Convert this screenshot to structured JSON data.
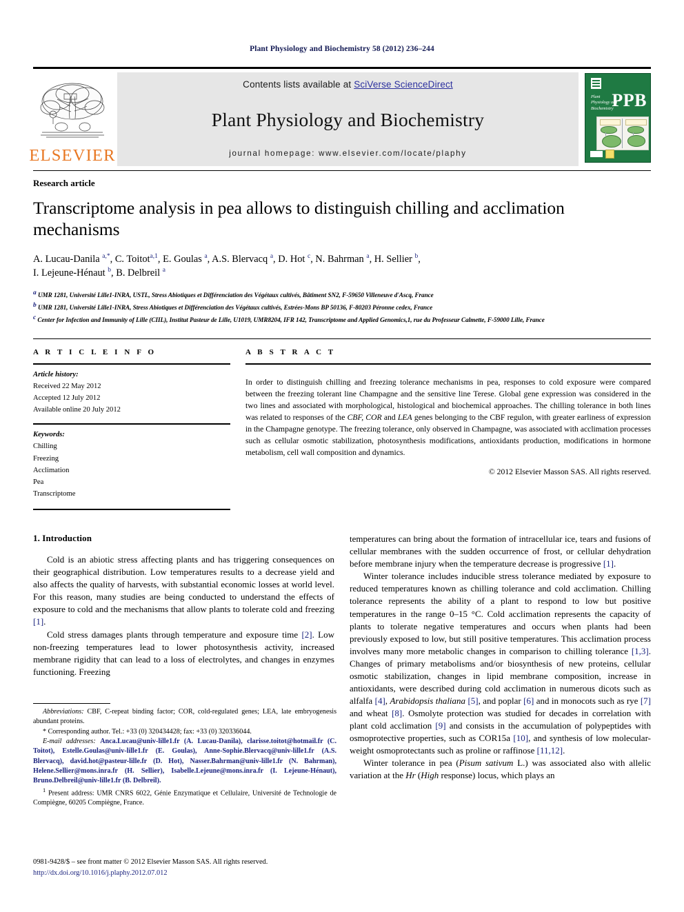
{
  "running_head": "Plant Physiology and Biochemistry 58 (2012) 236–244",
  "masthead": {
    "elsevier_wordmark": "ELSEVIER",
    "contents_prefix": "Contents lists available at ",
    "contents_link": "SciVerse ScienceDirect",
    "journal_name": "Plant Physiology and Biochemistry",
    "homepage": "journal homepage: www.elsevier.com/locate/plaphy",
    "cover": {
      "abbrev": "PPB",
      "journal_title_lines": "Plant Physiology and Biochemistry"
    }
  },
  "article": {
    "type": "Research article",
    "title": "Transcriptome analysis in pea allows to distinguish chilling and acclimation mechanisms",
    "authors_line1": "A. Lucau-Danila a,*, C. Toitot a,1, E. Goulas a, A.S. Blervacq a, D. Hot c, N. Bahrman a, H. Sellier b,",
    "authors_line2": "I. Lejeune-Hénaut b, B. Delbreil a",
    "affiliations": [
      "a UMR 1281, Université Lille1-INRA, USTL, Stress Abiotiques et Différenciation des Végétaux cultivés, Bâtiment SN2, F-59650 Villeneuve d'Ascq, France",
      "b UMR 1281, Université Lille1-INRA, Stress Abiotiques et Différenciation des Végétaux cultivés, Estrées-Mons BP 50136, F-80203 Péronne cedex, France",
      "c Center for Infection and Immunity of Lille (CIIL), Institut Pasteur de Lille, U1019, UMR8204, IFR 142, Transcriptome and Applied Genomics,1, rue du Professeur Calmette, F-59000 Lille, France"
    ]
  },
  "article_info": {
    "heading": "A R T I C L E  I N F O",
    "history_label": "Article history:",
    "history": [
      "Received 22 May 2012",
      "Accepted 12 July 2012",
      "Available online 20 July 2012"
    ],
    "keywords_label": "Keywords:",
    "keywords": [
      "Chilling",
      "Freezing",
      "Acclimation",
      "Pea",
      "Transcriptome"
    ]
  },
  "abstract": {
    "heading": "A B S T R A C T",
    "text_part1": "In order to distinguish chilling and freezing tolerance mechanisms in pea, responses to cold exposure were compared between the freezing tolerant line Champagne and the sensitive line Terese. Global gene expression was considered in the two lines and associated with morphological, histological and biochemical approaches. The chilling tolerance in both lines was related to responses of the ",
    "italic1": "CBF, COR",
    "text_part2": " and ",
    "italic2": "LEA",
    "text_part3": " genes belonging to the CBF regulon, with greater earliness of expression in the Champagne genotype. The freezing tolerance, only observed in Champagne, was associated with acclimation processes such as cellular osmotic stabilization, photosynthesis modifications, antioxidants production, modifications in hormone metabolism, cell wall composition and dynamics.",
    "copyright": "© 2012 Elsevier Masson SAS. All rights reserved."
  },
  "introduction": {
    "heading": "1. Introduction",
    "left_p1_a": "Cold is an abiotic stress affecting plants and has triggering consequences on their geographical distribution. Low temperatures results to a decrease yield and also affects the quality of harvests, with substantial economic losses at world level. For this reason, many studies are being conducted to understand the effects of exposure to cold and the mechanisms that allow plants to tolerate cold and freezing ",
    "left_p1_ref": "[1]",
    "left_p1_b": ".",
    "left_p2_a": "Cold stress damages plants through temperature and exposure time ",
    "left_p2_ref": "[2]",
    "left_p2_b": ". Low non-freezing temperatures lead to lower photosynthesis activity, increased membrane rigidity that can lead to a loss of electrolytes, and changes in enzymes functioning. Freezing",
    "right_p1_a": "temperatures can bring about the formation of intracellular ice, tears and fusions of cellular membranes with the sudden occurrence of frost, or cellular dehydration before membrane injury when the temperature decrease is progressive ",
    "right_p1_ref": "[1]",
    "right_p1_b": ".",
    "right_p2_a": "Winter tolerance includes inducible stress tolerance mediated by exposure to reduced temperatures known as chilling tolerance and cold acclimation. Chilling tolerance represents the ability of a plant to respond to low but positive temperatures in the range 0–15 °C. Cold acclimation represents the capacity of plants to tolerate negative temperatures and occurs when plants had been previously exposed to low, but still positive temperatures. This acclimation process involves many more metabolic changes in comparison to chilling tolerance ",
    "right_p2_ref1": "[1,3]",
    "right_p2_b": ". Changes of primary metabolisms and/or biosynthesis of new proteins, cellular osmotic stabilization, changes in lipid membrane composition, increase in antioxidants, were described during cold acclimation in numerous dicots such as alfalfa ",
    "right_p2_ref2": "[4]",
    "right_p2_c": ", ",
    "right_p2_italic1": "Arabidopsis thaliana",
    "right_p2_ref3": "[5]",
    "right_p2_d": ", and poplar ",
    "right_p2_ref4": "[6]",
    "right_p2_e": " and in monocots such as rye ",
    "right_p2_ref5": "[7]",
    "right_p2_f": " and wheat ",
    "right_p2_ref6": "[8]",
    "right_p2_g": ". Osmolyte protection was studied for decades in correlation with plant cold acclimation ",
    "right_p2_ref7": "[9]",
    "right_p2_h": " and consists in the accumulation of polypeptides with osmoprotective properties, such as COR15a ",
    "right_p2_ref8": "[10]",
    "right_p2_i": ", and synthesis of low molecular-weight osmoprotectants such as proline or raffinose ",
    "right_p2_ref9": "[11,12]",
    "right_p2_j": ".",
    "right_p3_a": "Winter tolerance in pea (",
    "right_p3_italic1": "Pisum sativum",
    "right_p3_b": " L.) was associated also with allelic variation at the ",
    "right_p3_italic2": "Hr",
    "right_p3_c": " (",
    "right_p3_italic3": "High",
    "right_p3_d": " response) locus, which plays an"
  },
  "footnotes": {
    "abbrev_label": "Abbreviations:",
    "abbrev_text": " CBF, C-repeat binding factor; COR, cold-regulated genes; LEA, late embryogenesis abundant proteins.",
    "corresponding": "* Corresponding author. Tel.: +33 (0) 320434428; fax: +33 (0) 320336044.",
    "email_label": "E-mail addresses:",
    "emails": "Anca.Lucau@univ-lille1.fr (A. Lucau-Danila), clarisse.toitot@hotmail.fr (C. Toitot), Estelle.Goulas@univ-lille1.fr (E. Goulas), Anne-Sophie.Blervacq@univ-lille1.fr (A.S. Blervacq), david.hot@pasteur-lille.fr (D. Hot), Nasser.Bahrman@univ-lille1.fr (N. Bahrman), Helene.Sellier@mons.inra.fr (H. Sellier), Isabelle.Lejeune@mons.inra.fr (I. Lejeune-Hénaut), Bruno.Delbreil@univ-lille1.fr (B. Delbreil).",
    "present_address_marker": "1",
    "present_address": " Present address: UMR CNRS 6022, Génie Enzymatique et Cellulaire, Université de Technologie de Compiègne, 60205 Compiègne, France."
  },
  "page_footer": {
    "issn_line": "0981-9428/$ – see front matter © 2012 Elsevier Masson SAS. All rights reserved.",
    "doi": "http://dx.doi.org/10.1016/j.plaphy.2012.07.012"
  },
  "colors": {
    "link_blue": "#1b237e",
    "sd_blue": "#2b2f9e",
    "elsevier_orange": "#e87722",
    "band_grey": "#e6e6e6",
    "cover_green": "#1f7a43"
  }
}
